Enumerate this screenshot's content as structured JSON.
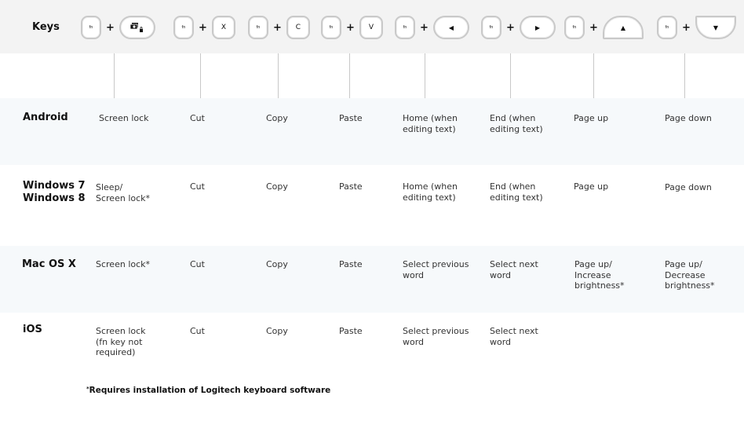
{
  "header": {
    "keys_label": "Keys",
    "combos": [
      {
        "mod": "fn",
        "key": "screen-lock-icon",
        "key_label": "⧉🔒"
      },
      {
        "mod": "fn",
        "key": "x",
        "key_label": "X"
      },
      {
        "mod": "fn",
        "key": "c",
        "key_label": "C"
      },
      {
        "mod": "fn",
        "key": "v",
        "key_label": "V"
      },
      {
        "mod": "fn",
        "key": "left-arrow",
        "key_label": "◀"
      },
      {
        "mod": "fn",
        "key": "right-arrow",
        "key_label": "▶"
      },
      {
        "mod": "fn",
        "key": "up-arrow",
        "key_label": "▲"
      },
      {
        "mod": "fn",
        "key": "down-arrow",
        "key_label": "▼"
      }
    ],
    "plus": "+",
    "fn_label": "fn"
  },
  "rows": [
    {
      "os": "Android",
      "cells": [
        "Screen lock",
        "Cut",
        "Copy",
        "Paste",
        "Home (when\nediting text)",
        "End (when\nediting text)",
        "Page up",
        "Page down"
      ]
    },
    {
      "os": "Windows 7\nWindows 8",
      "cells": [
        "Sleep/\nScreen lock*",
        "Cut",
        "Copy",
        "Paste",
        "Home (when\nediting text)",
        "End (when\nediting text)",
        "Page up",
        "Page down"
      ]
    },
    {
      "os": "Mac OS X",
      "cells": [
        "Screen lock*",
        "Cut",
        "Copy",
        "Paste",
        "Select previous\nword",
        "Select next\nword",
        "Page up/\nIncrease\nbrightness*",
        "Page up/\nDecrease\nbrightness*"
      ]
    },
    {
      "os": "iOS",
      "cells": [
        "Screen lock\n(fn key not\nrequired)",
        "Cut",
        "Copy",
        "Paste",
        "Select previous\nword",
        "Select next\nword",
        "",
        ""
      ]
    }
  ],
  "footnote": {
    "marker": "*",
    "text": "Requires installation of Logitech keyboard software"
  }
}
